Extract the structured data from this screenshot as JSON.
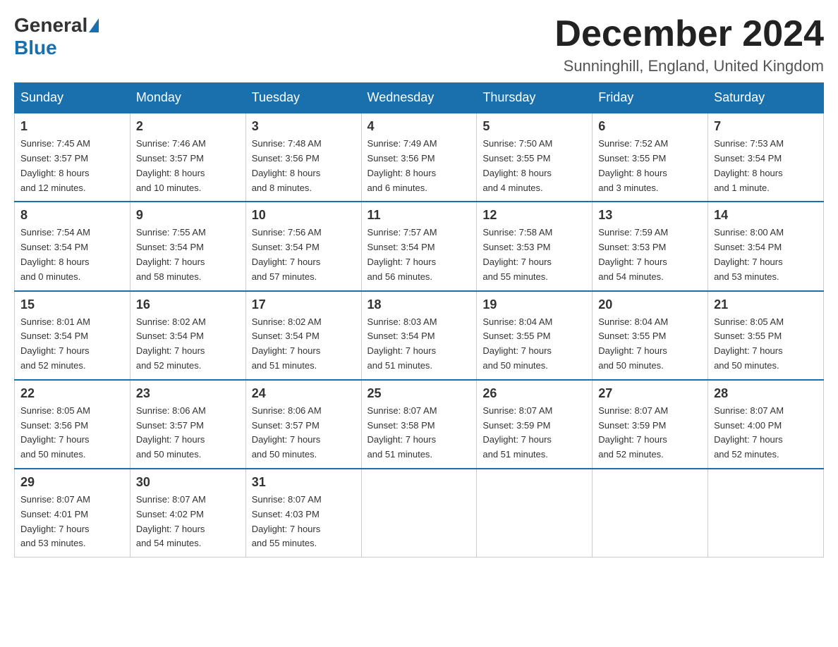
{
  "logo": {
    "text_before": "General",
    "text_after": "Blue"
  },
  "header": {
    "month": "December 2024",
    "location": "Sunninghill, England, United Kingdom"
  },
  "days_of_week": [
    "Sunday",
    "Monday",
    "Tuesday",
    "Wednesday",
    "Thursday",
    "Friday",
    "Saturday"
  ],
  "weeks": [
    [
      {
        "day": "1",
        "info": "Sunrise: 7:45 AM\nSunset: 3:57 PM\nDaylight: 8 hours\nand 12 minutes."
      },
      {
        "day": "2",
        "info": "Sunrise: 7:46 AM\nSunset: 3:57 PM\nDaylight: 8 hours\nand 10 minutes."
      },
      {
        "day": "3",
        "info": "Sunrise: 7:48 AM\nSunset: 3:56 PM\nDaylight: 8 hours\nand 8 minutes."
      },
      {
        "day": "4",
        "info": "Sunrise: 7:49 AM\nSunset: 3:56 PM\nDaylight: 8 hours\nand 6 minutes."
      },
      {
        "day": "5",
        "info": "Sunrise: 7:50 AM\nSunset: 3:55 PM\nDaylight: 8 hours\nand 4 minutes."
      },
      {
        "day": "6",
        "info": "Sunrise: 7:52 AM\nSunset: 3:55 PM\nDaylight: 8 hours\nand 3 minutes."
      },
      {
        "day": "7",
        "info": "Sunrise: 7:53 AM\nSunset: 3:54 PM\nDaylight: 8 hours\nand 1 minute."
      }
    ],
    [
      {
        "day": "8",
        "info": "Sunrise: 7:54 AM\nSunset: 3:54 PM\nDaylight: 8 hours\nand 0 minutes."
      },
      {
        "day": "9",
        "info": "Sunrise: 7:55 AM\nSunset: 3:54 PM\nDaylight: 7 hours\nand 58 minutes."
      },
      {
        "day": "10",
        "info": "Sunrise: 7:56 AM\nSunset: 3:54 PM\nDaylight: 7 hours\nand 57 minutes."
      },
      {
        "day": "11",
        "info": "Sunrise: 7:57 AM\nSunset: 3:54 PM\nDaylight: 7 hours\nand 56 minutes."
      },
      {
        "day": "12",
        "info": "Sunrise: 7:58 AM\nSunset: 3:53 PM\nDaylight: 7 hours\nand 55 minutes."
      },
      {
        "day": "13",
        "info": "Sunrise: 7:59 AM\nSunset: 3:53 PM\nDaylight: 7 hours\nand 54 minutes."
      },
      {
        "day": "14",
        "info": "Sunrise: 8:00 AM\nSunset: 3:54 PM\nDaylight: 7 hours\nand 53 minutes."
      }
    ],
    [
      {
        "day": "15",
        "info": "Sunrise: 8:01 AM\nSunset: 3:54 PM\nDaylight: 7 hours\nand 52 minutes."
      },
      {
        "day": "16",
        "info": "Sunrise: 8:02 AM\nSunset: 3:54 PM\nDaylight: 7 hours\nand 52 minutes."
      },
      {
        "day": "17",
        "info": "Sunrise: 8:02 AM\nSunset: 3:54 PM\nDaylight: 7 hours\nand 51 minutes."
      },
      {
        "day": "18",
        "info": "Sunrise: 8:03 AM\nSunset: 3:54 PM\nDaylight: 7 hours\nand 51 minutes."
      },
      {
        "day": "19",
        "info": "Sunrise: 8:04 AM\nSunset: 3:55 PM\nDaylight: 7 hours\nand 50 minutes."
      },
      {
        "day": "20",
        "info": "Sunrise: 8:04 AM\nSunset: 3:55 PM\nDaylight: 7 hours\nand 50 minutes."
      },
      {
        "day": "21",
        "info": "Sunrise: 8:05 AM\nSunset: 3:55 PM\nDaylight: 7 hours\nand 50 minutes."
      }
    ],
    [
      {
        "day": "22",
        "info": "Sunrise: 8:05 AM\nSunset: 3:56 PM\nDaylight: 7 hours\nand 50 minutes."
      },
      {
        "day": "23",
        "info": "Sunrise: 8:06 AM\nSunset: 3:57 PM\nDaylight: 7 hours\nand 50 minutes."
      },
      {
        "day": "24",
        "info": "Sunrise: 8:06 AM\nSunset: 3:57 PM\nDaylight: 7 hours\nand 50 minutes."
      },
      {
        "day": "25",
        "info": "Sunrise: 8:07 AM\nSunset: 3:58 PM\nDaylight: 7 hours\nand 51 minutes."
      },
      {
        "day": "26",
        "info": "Sunrise: 8:07 AM\nSunset: 3:59 PM\nDaylight: 7 hours\nand 51 minutes."
      },
      {
        "day": "27",
        "info": "Sunrise: 8:07 AM\nSunset: 3:59 PM\nDaylight: 7 hours\nand 52 minutes."
      },
      {
        "day": "28",
        "info": "Sunrise: 8:07 AM\nSunset: 4:00 PM\nDaylight: 7 hours\nand 52 minutes."
      }
    ],
    [
      {
        "day": "29",
        "info": "Sunrise: 8:07 AM\nSunset: 4:01 PM\nDaylight: 7 hours\nand 53 minutes."
      },
      {
        "day": "30",
        "info": "Sunrise: 8:07 AM\nSunset: 4:02 PM\nDaylight: 7 hours\nand 54 minutes."
      },
      {
        "day": "31",
        "info": "Sunrise: 8:07 AM\nSunset: 4:03 PM\nDaylight: 7 hours\nand 55 minutes."
      },
      {
        "day": "",
        "info": ""
      },
      {
        "day": "",
        "info": ""
      },
      {
        "day": "",
        "info": ""
      },
      {
        "day": "",
        "info": ""
      }
    ]
  ]
}
